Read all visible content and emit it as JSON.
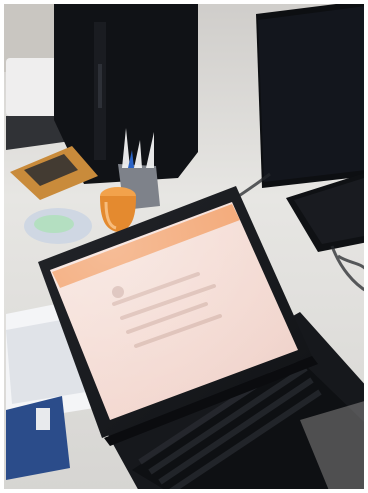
{
  "scene": {
    "kind": "photo",
    "subject": "laptop-on-office-desk",
    "colors": {
      "desk": "#e8e6e2",
      "tower": "#111216",
      "monitor": "#0d0f12",
      "laptop_body": "#1b1d21",
      "laptop_screen": "#f4ddd5",
      "browser_accent": "#f2a06a",
      "mug": "#e48a2f",
      "binder": "#2b4c8a",
      "cork_pad": "#c98b3b"
    },
    "objects": [
      {
        "name": "pc-tower"
      },
      {
        "name": "external-monitor"
      },
      {
        "name": "keyboard"
      },
      {
        "name": "pen-holder"
      },
      {
        "name": "orange-mug"
      },
      {
        "name": "laptop"
      },
      {
        "name": "papers"
      },
      {
        "name": "blue-binder"
      },
      {
        "name": "cables"
      }
    ]
  }
}
